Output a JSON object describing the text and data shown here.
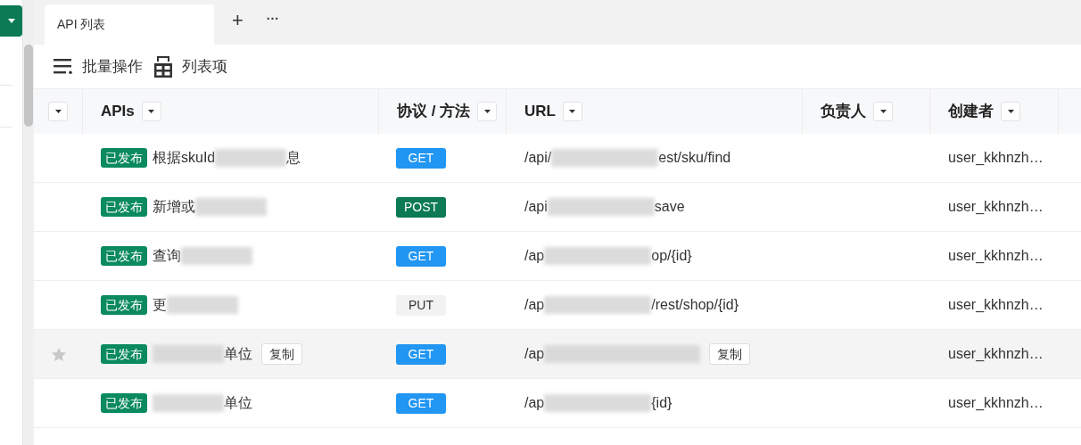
{
  "tabs": [
    {
      "label": "API 列表",
      "selected": true
    }
  ],
  "tab_actions": {
    "add": "+",
    "more": "···"
  },
  "toolbar": [
    {
      "kind": "batch",
      "label": "批量操作"
    },
    {
      "kind": "columns",
      "label": "列表项"
    }
  ],
  "table": {
    "columns": [
      {
        "label": "APIs"
      },
      {
        "label": "协议 / 方法"
      },
      {
        "label": "URL"
      },
      {
        "label": "负责人"
      },
      {
        "label": "创建者"
      }
    ],
    "rows": [
      {
        "hovered": false,
        "status": "已发布",
        "name_start": "根据skuId",
        "name_end": "息",
        "method": {
          "kind": "get",
          "label": "GET"
        },
        "url_start": "/api/",
        "url_end": "est/sku/find",
        "creator": "user_kkhnzh…"
      },
      {
        "hovered": false,
        "status": "已发布",
        "name_start": "新增或",
        "method": {
          "kind": "post",
          "label": "POST"
        },
        "url_start": "/api",
        "url_end": "save",
        "creator": "user_kkhnzh…"
      },
      {
        "hovered": false,
        "status": "已发布",
        "name_start": "查询",
        "method": {
          "kind": "get",
          "label": "GET"
        },
        "url_start": "/ap",
        "url_end": "op/{id}",
        "creator": "user_kkhnzh…"
      },
      {
        "hovered": false,
        "status": "已发布",
        "name_start": "更",
        "method": {
          "kind": "put",
          "label": "PUT"
        },
        "url_start": "/ap",
        "url_end": "/rest/shop/{id}",
        "creator": "user_kkhnzh…"
      },
      {
        "hovered": true,
        "status": "已发布",
        "name_end": "单位",
        "name_copy": "复制",
        "method": {
          "kind": "get",
          "label": "GET"
        },
        "url_start": "/ap",
        "url_copy": "复制",
        "creator": "user_kkhnzh…"
      },
      {
        "hovered": false,
        "status": "已发布",
        "name_end": "单位",
        "method": {
          "kind": "get",
          "label": "GET"
        },
        "url_start": "/ap",
        "url_end": "{id}",
        "creator": "user_kkhnzh…"
      }
    ]
  }
}
